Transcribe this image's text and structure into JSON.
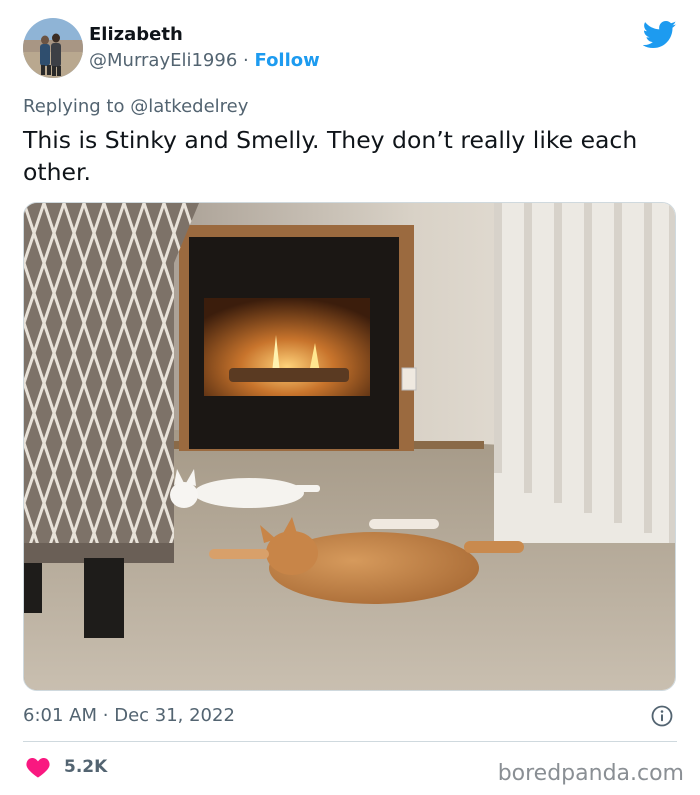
{
  "tweet": {
    "author_name": "Elizabeth",
    "author_handle": "@MurrayEli1996",
    "separator": "·",
    "follow_label": "Follow",
    "reply_prefix": "Replying to",
    "reply_to": "@latkedelrey",
    "text": "This is Stinky and Smelly. They don’t really like each other.",
    "time": "6:01 AM",
    "date": "Dec 31, 2022",
    "likes": "5.2K"
  },
  "icons": {
    "platform": "twitter-bird-icon",
    "info": "info-icon",
    "like": "heart-icon"
  },
  "colors": {
    "accent": "#1d9bf0",
    "heart": "#f91880",
    "secondary_text": "#536471"
  },
  "watermark": "boredpanda.com"
}
